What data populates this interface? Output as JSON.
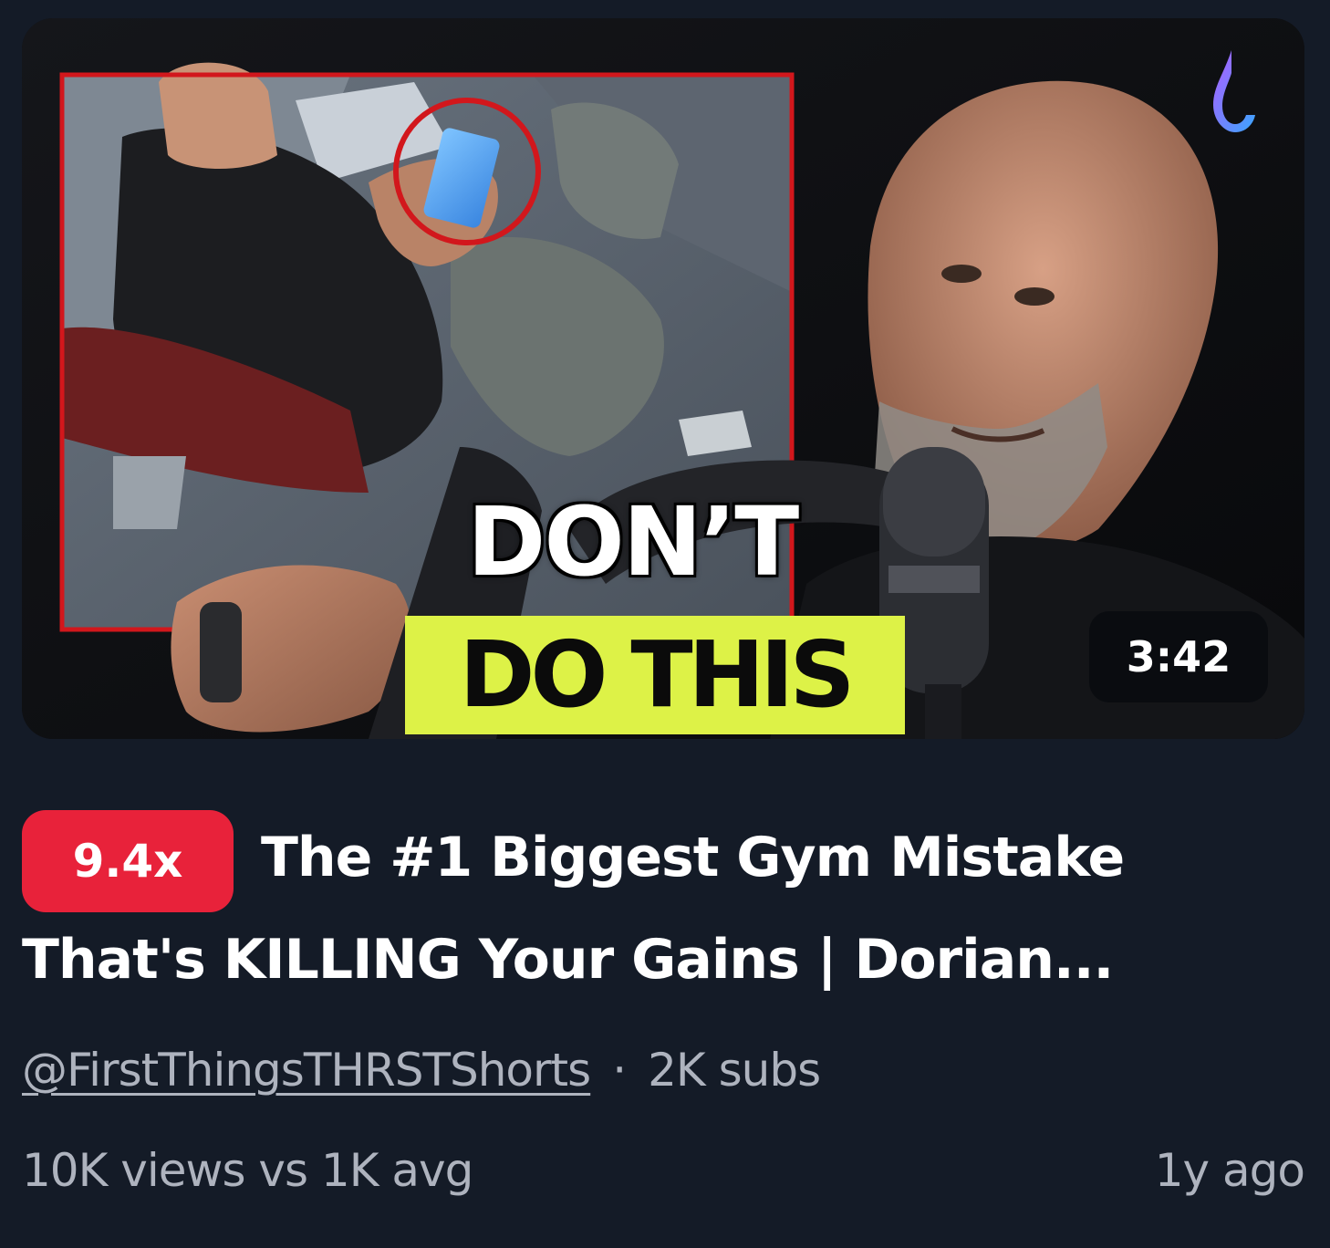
{
  "thumbnail": {
    "overlay_line1": "DON’T",
    "overlay_line2": "DO THIS",
    "duration": "3:42",
    "highlight_color": "#ddf247",
    "frame_color": "#d2171c"
  },
  "video": {
    "outlier_multiplier": "9.4x",
    "title": "The #1 Biggest Gym Mistake That's KILLING Your Gains | Dorian...",
    "channel_handle": "@FirstThingsTHRSTShorts",
    "separator": "·",
    "subscribers": "2K subs",
    "views_comparison": "10K views vs 1K avg",
    "age": "1y ago"
  },
  "colors": {
    "background": "#141b27",
    "badge_red": "#e8223a",
    "meta_text": "#aeb3be"
  }
}
